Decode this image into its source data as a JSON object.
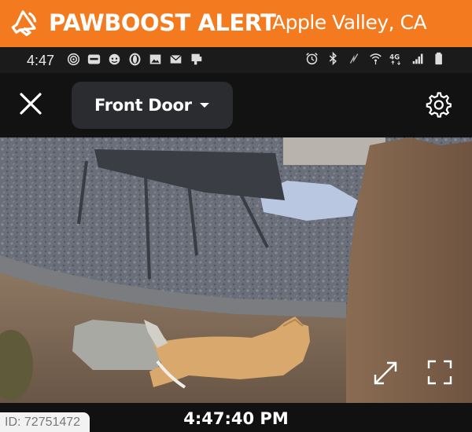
{
  "banner": {
    "brand": "PAWBOOST ALERT",
    "location": "Apple Valley, CA",
    "icon": "megaphone-icon",
    "color": "#f47a20"
  },
  "statusbar": {
    "time": "4:47",
    "left_icons": [
      "hotspot-icon",
      "ring-icon",
      "cat-icon",
      "opera-icon",
      "gallery-icon",
      "mail-icon",
      "device-icon"
    ],
    "right_icons": [
      "alarm-icon",
      "bluetooth-icon",
      "nfc-icon",
      "wifi-icon",
      "4g-icon",
      "signal-icon",
      "battery-icon"
    ],
    "network": "4G"
  },
  "camera": {
    "name": "Front Door",
    "timestamp": "4:47:40 PM"
  },
  "footer": {
    "id_label": "ID: 72751472"
  }
}
